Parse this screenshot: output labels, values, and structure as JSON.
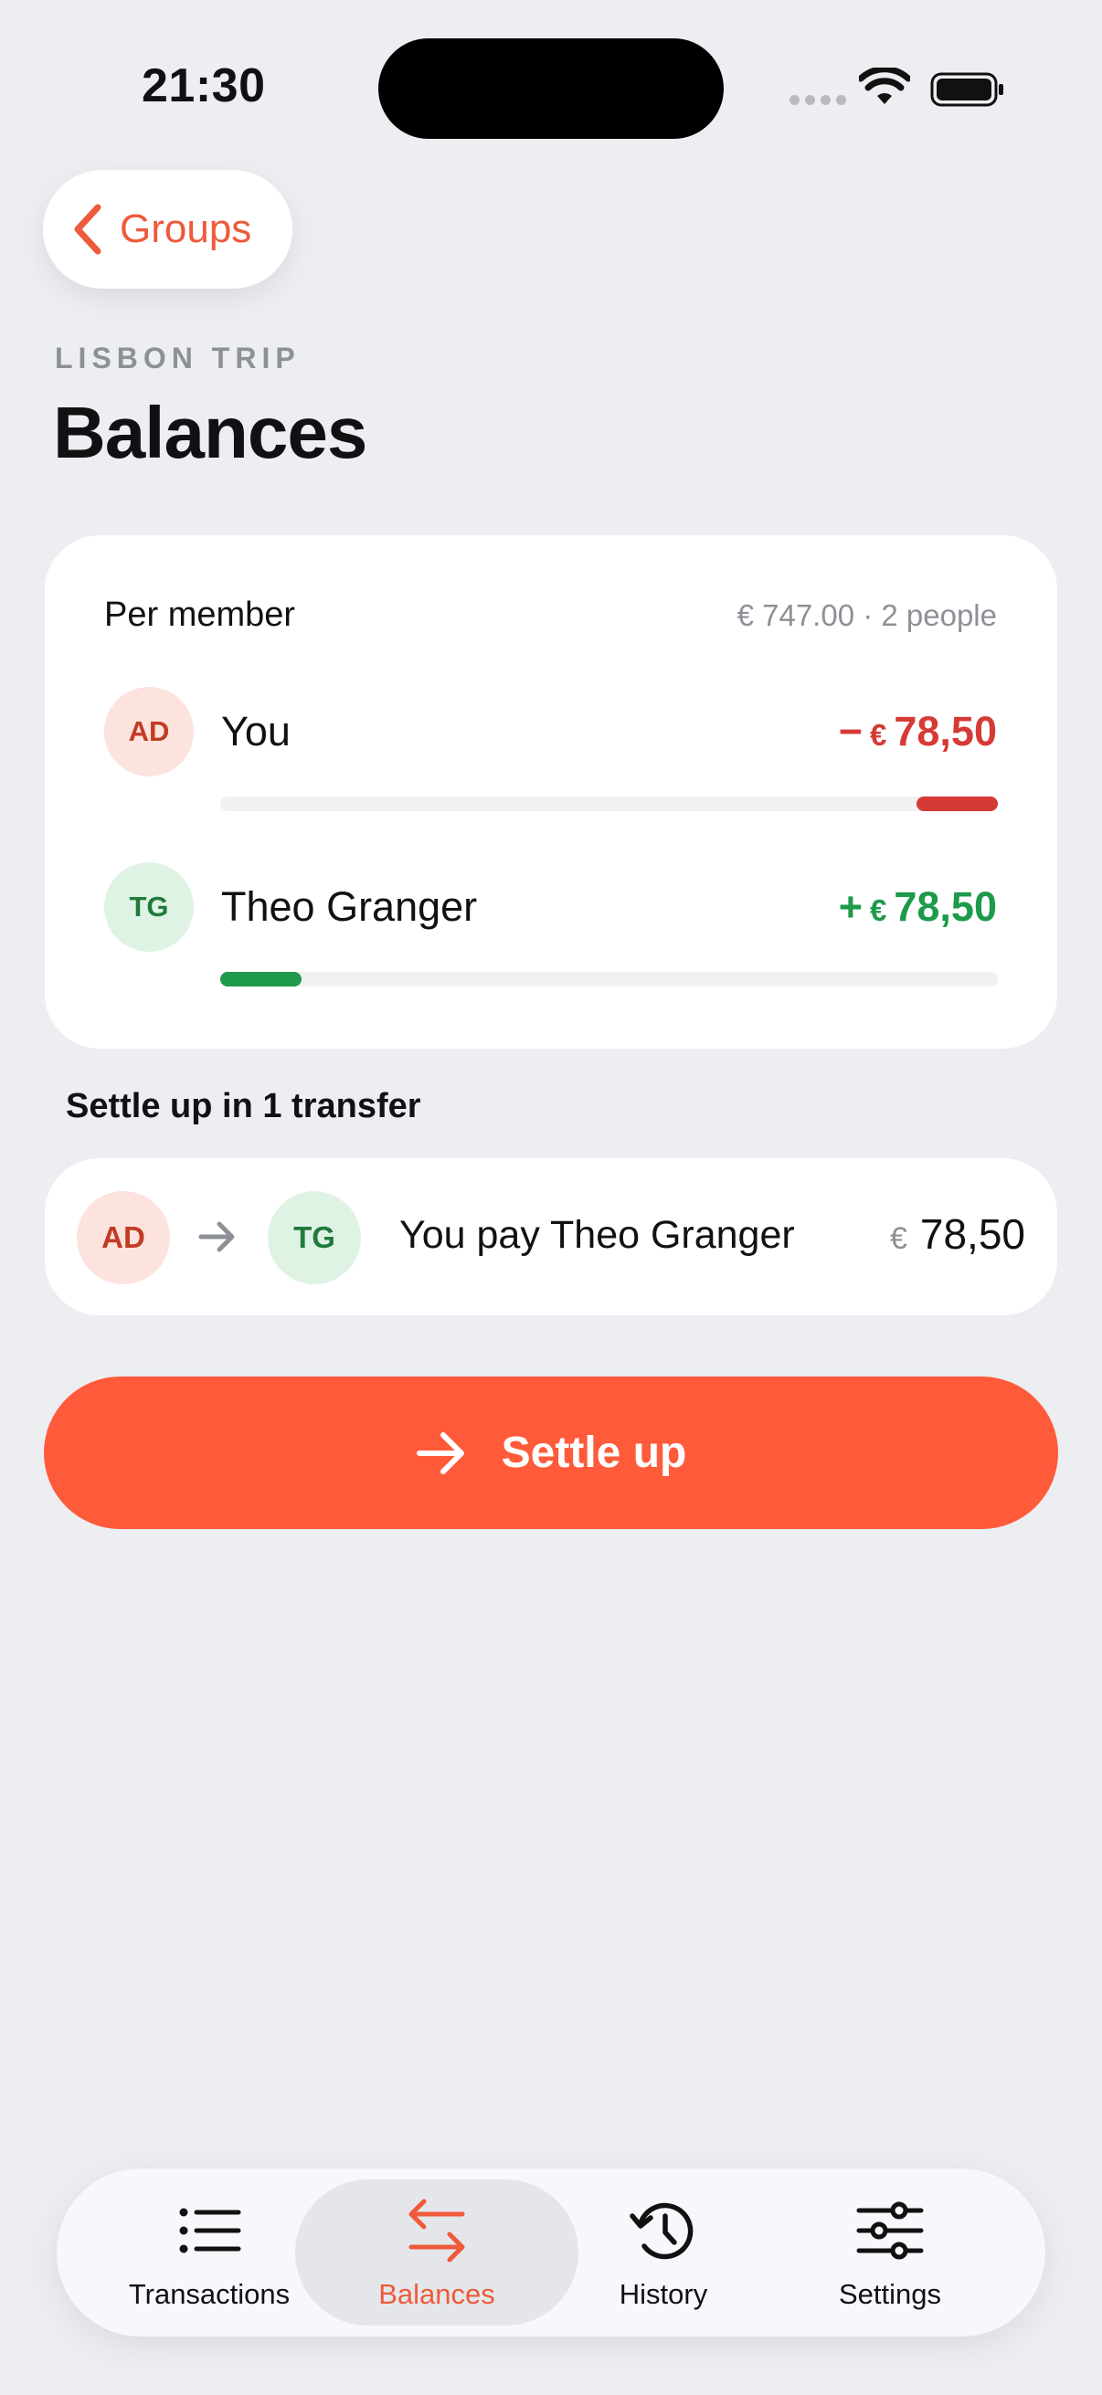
{
  "status_bar": {
    "time": "21:30"
  },
  "nav": {
    "back_label": "Groups"
  },
  "header": {
    "eyebrow": "LISBON TRIP",
    "title": "Balances"
  },
  "members_card": {
    "title": "Per member",
    "meta": "€ 747.00 · 2 people",
    "members": [
      {
        "initials": "AD",
        "name": "You",
        "sign": "−",
        "currency": "€",
        "amount": "78,50",
        "status": "owes",
        "bar_fraction": 0.105,
        "bar_side": "right",
        "color": "#D63A35"
      },
      {
        "initials": "TG",
        "name": "Theo Granger",
        "sign": "+",
        "currency": "€",
        "amount": "78,50",
        "status": "owed",
        "bar_fraction": 0.105,
        "bar_side": "left",
        "color": "#1D9A4A"
      }
    ]
  },
  "settle_section": {
    "label": "Settle up in 1 transfer",
    "transfer": {
      "from_initials": "AD",
      "to_initials": "TG",
      "text": "You pay Theo Granger",
      "currency": "€",
      "amount": "78,50"
    }
  },
  "settle_button": {
    "label": "Settle up",
    "icon": "arrow-right-icon"
  },
  "tabbar": {
    "tabs": [
      {
        "label": "Transactions",
        "icon": "list-icon",
        "active": false
      },
      {
        "label": "Balances",
        "icon": "transfer-arrows-icon",
        "active": true
      },
      {
        "label": "History",
        "icon": "history-clock-icon",
        "active": false
      },
      {
        "label": "Settings",
        "icon": "sliders-icon",
        "active": false
      }
    ]
  },
  "colors": {
    "accent": "#FF5A3A",
    "negative": "#D63A35",
    "positive": "#1D9A4A",
    "background": "#EDEEF2"
  }
}
